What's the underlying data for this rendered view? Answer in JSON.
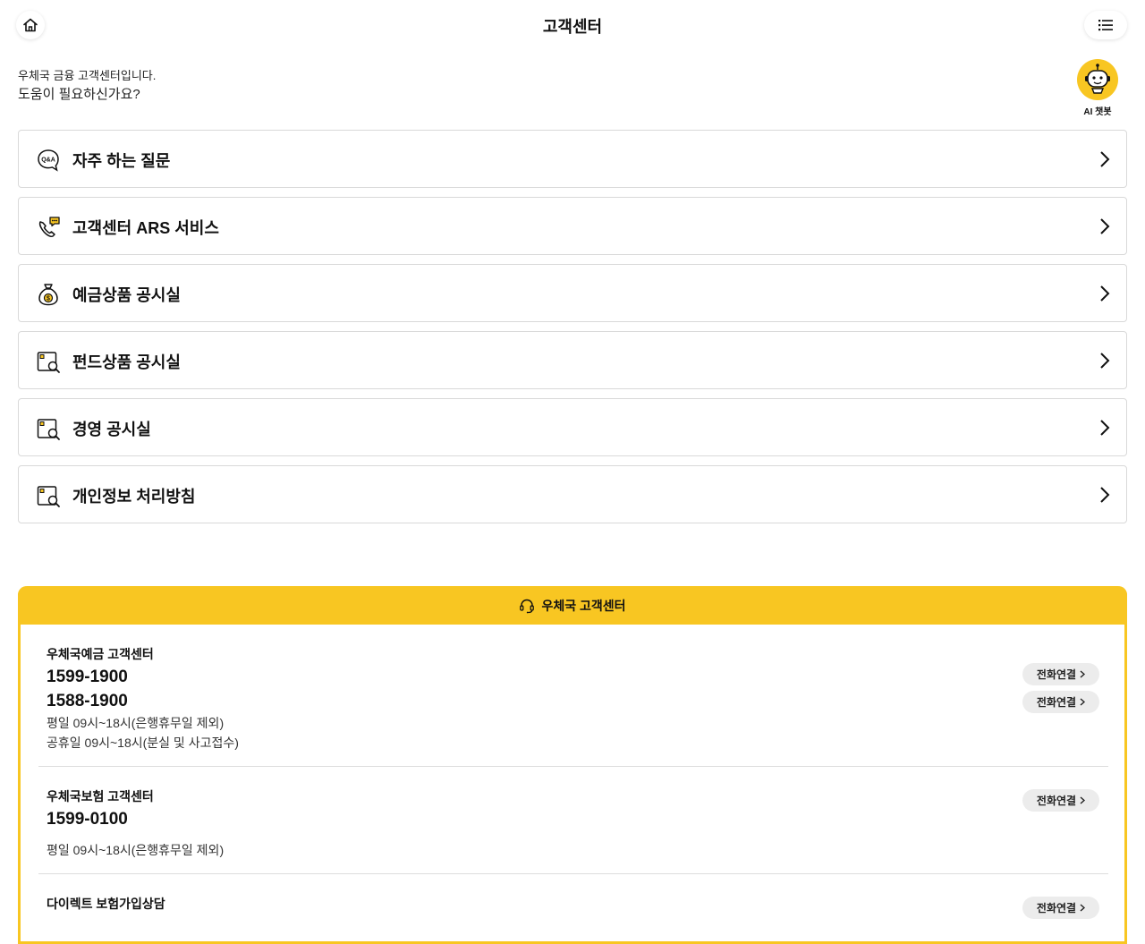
{
  "header": {
    "title": "고객센터",
    "home_icon": "home-icon",
    "menu_icon": "list-menu-icon"
  },
  "intro": {
    "line1": "우체국 금융 고객센터입니다.",
    "line2": "도움이 필요하신가요?"
  },
  "chatbot": {
    "label": "AI 챗봇",
    "icon": "robot-chatbot-icon",
    "color": "#f8c622"
  },
  "menu": [
    {
      "label": "자주 하는 질문",
      "icon": "qa-bubble-icon"
    },
    {
      "label": "고객센터 ARS 서비스",
      "icon": "phone-chat-icon"
    },
    {
      "label": "예금상품 공시실",
      "icon": "money-bag-icon"
    },
    {
      "label": "펀드상품 공시실",
      "icon": "document-search-icon"
    },
    {
      "label": "경영 공시실",
      "icon": "document-search-icon"
    },
    {
      "label": "개인정보 처리방침",
      "icon": "document-search-icon"
    }
  ],
  "customer_center": {
    "title": "우체국 고객센터",
    "icon": "headset-icon",
    "accent_color": "#f8c622",
    "call_label": "전화연결",
    "centers": [
      {
        "name": "우체국예금 고객센터",
        "numbers": [
          "1599-1900",
          "1588-1900"
        ],
        "hours": [
          "평일 09시~18시(은행휴무일 제외)",
          "공휴일 09시~18시(분실 및 사고접수)"
        ]
      },
      {
        "name": "우체국보험 고객센터",
        "numbers": [
          "1599-0100"
        ],
        "hours": [
          "평일 09시~18시(은행휴무일 제외)"
        ]
      },
      {
        "name": "다이렉트 보험가입상담",
        "numbers": [],
        "hours": []
      }
    ]
  }
}
